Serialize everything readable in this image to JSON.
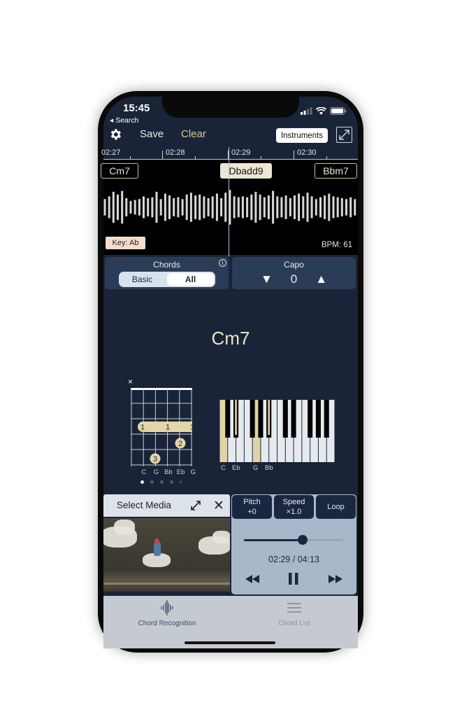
{
  "status_bar": {
    "time": "15:45",
    "back_label": "Search"
  },
  "toolbar": {
    "settings_icon": "gear-icon",
    "save_label": "Save",
    "clear_label": "Clear",
    "instruments_label": "Instruments",
    "fullscreen_icon": "expand-icon"
  },
  "timeline": {
    "ticks": [
      "02:27",
      "02:28",
      "02:29",
      "02:30"
    ],
    "chords": [
      {
        "label": "Cm7",
        "active": false
      },
      {
        "label": "Dbadd9",
        "active": true
      },
      {
        "label": "Bbm7",
        "active": false
      }
    ],
    "key_label": "Key: Ab",
    "bpm_label": "BPM: 61",
    "waveform": [
      0.45,
      0.6,
      0.85,
      0.7,
      0.9,
      0.5,
      0.35,
      0.4,
      0.45,
      0.6,
      0.5,
      0.55,
      0.85,
      0.45,
      0.75,
      0.65,
      0.5,
      0.55,
      0.45,
      0.7,
      0.8,
      0.65,
      0.7,
      0.6,
      0.5,
      0.6,
      0.75,
      0.5,
      0.8,
      0.95,
      0.6,
      0.55,
      0.6,
      0.55,
      0.7,
      0.85,
      0.7,
      0.55,
      0.65,
      0.9,
      0.6,
      0.55,
      0.65,
      0.5,
      0.65,
      0.75,
      0.6,
      0.8,
      0.6,
      0.45,
      0.55,
      0.65,
      0.75,
      0.6,
      0.55,
      0.5,
      0.45,
      0.55,
      0.45
    ]
  },
  "chords_panel": {
    "title": "Chords",
    "options": [
      "Basic",
      "All"
    ],
    "selected": "All",
    "info_icon": "info-icon"
  },
  "capo_panel": {
    "title": "Capo",
    "value": "0",
    "down_icon": "triangle-down-icon",
    "up_icon": "triangle-up-icon"
  },
  "current_chord": {
    "name": "Cm7",
    "guitar": {
      "muted_string_marker": "×",
      "string_labels": [
        "C",
        "G",
        "Bb",
        "Eb",
        "G"
      ],
      "barre": {
        "fret": 3,
        "finger": "1",
        "labels": [
          "1",
          "1",
          "1"
        ]
      },
      "fingers": [
        {
          "string": 4,
          "fret": 4,
          "finger": "2"
        },
        {
          "string": 2,
          "fret": 5,
          "finger": "3"
        }
      ],
      "page_count": 5,
      "page_index": 0
    },
    "piano": {
      "highlighted_notes": [
        "C",
        "Eb",
        "G",
        "Bb"
      ],
      "labels": [
        "C",
        "Eb",
        "G",
        "Bb"
      ]
    }
  },
  "media": {
    "title": "Select Media",
    "expand_icon": "expand-icon",
    "close_label": "✕"
  },
  "player": {
    "pitch_label": "Pitch",
    "pitch_value": "+0",
    "speed_label": "Speed",
    "speed_value": "×1.0",
    "loop_label": "Loop",
    "progress": 0.589,
    "time_readout": "02:29 / 04:13",
    "rewind_icon": "rewind-icon",
    "pause_icon": "pause-icon",
    "forward_icon": "fast-forward-icon"
  },
  "tabs": [
    {
      "label": "Chord Recognition",
      "icon": "waveform-icon",
      "active": true
    },
    {
      "label": "Chord List",
      "icon": "list-icon",
      "active": false
    }
  ],
  "colors": {
    "accent": "#d8c995",
    "background": "#1a2438",
    "panel": "#2b3c57",
    "player": "#a8b8cb"
  }
}
